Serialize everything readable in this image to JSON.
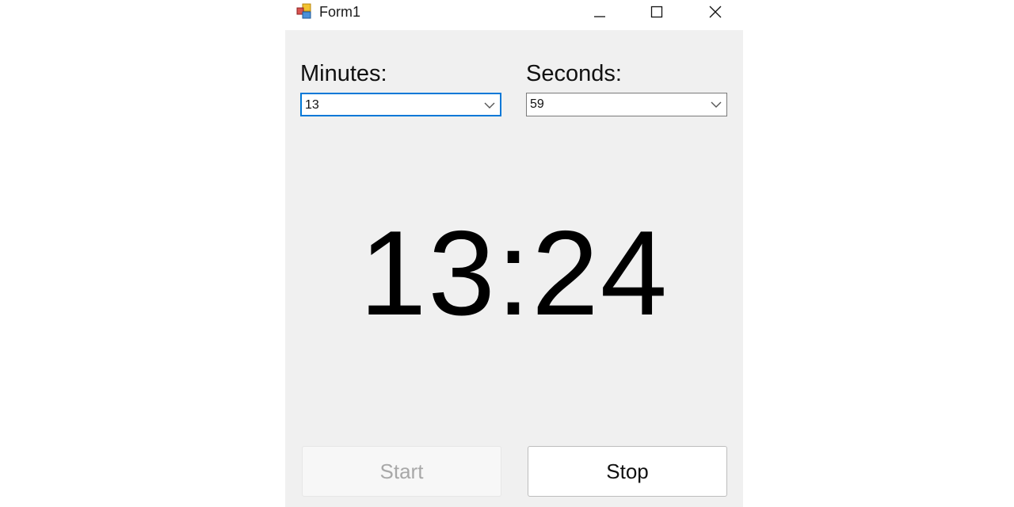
{
  "window": {
    "title": "Form1",
    "icon": "winforms-app-icon",
    "controls": {
      "minimize_icon": "minimize-icon",
      "maximize_icon": "maximize-icon",
      "close_icon": "close-icon"
    }
  },
  "minutes": {
    "label": "Minutes:",
    "value": "13"
  },
  "seconds": {
    "label": "Seconds:",
    "value": "59"
  },
  "display": {
    "time": "13:24"
  },
  "buttons": {
    "start_label": "Start",
    "start_enabled": false,
    "stop_label": "Stop",
    "stop_enabled": true
  },
  "colors": {
    "focus_border": "#0078d7",
    "form_background": "#f0f0f0",
    "disabled_text": "#a8a8a8"
  }
}
